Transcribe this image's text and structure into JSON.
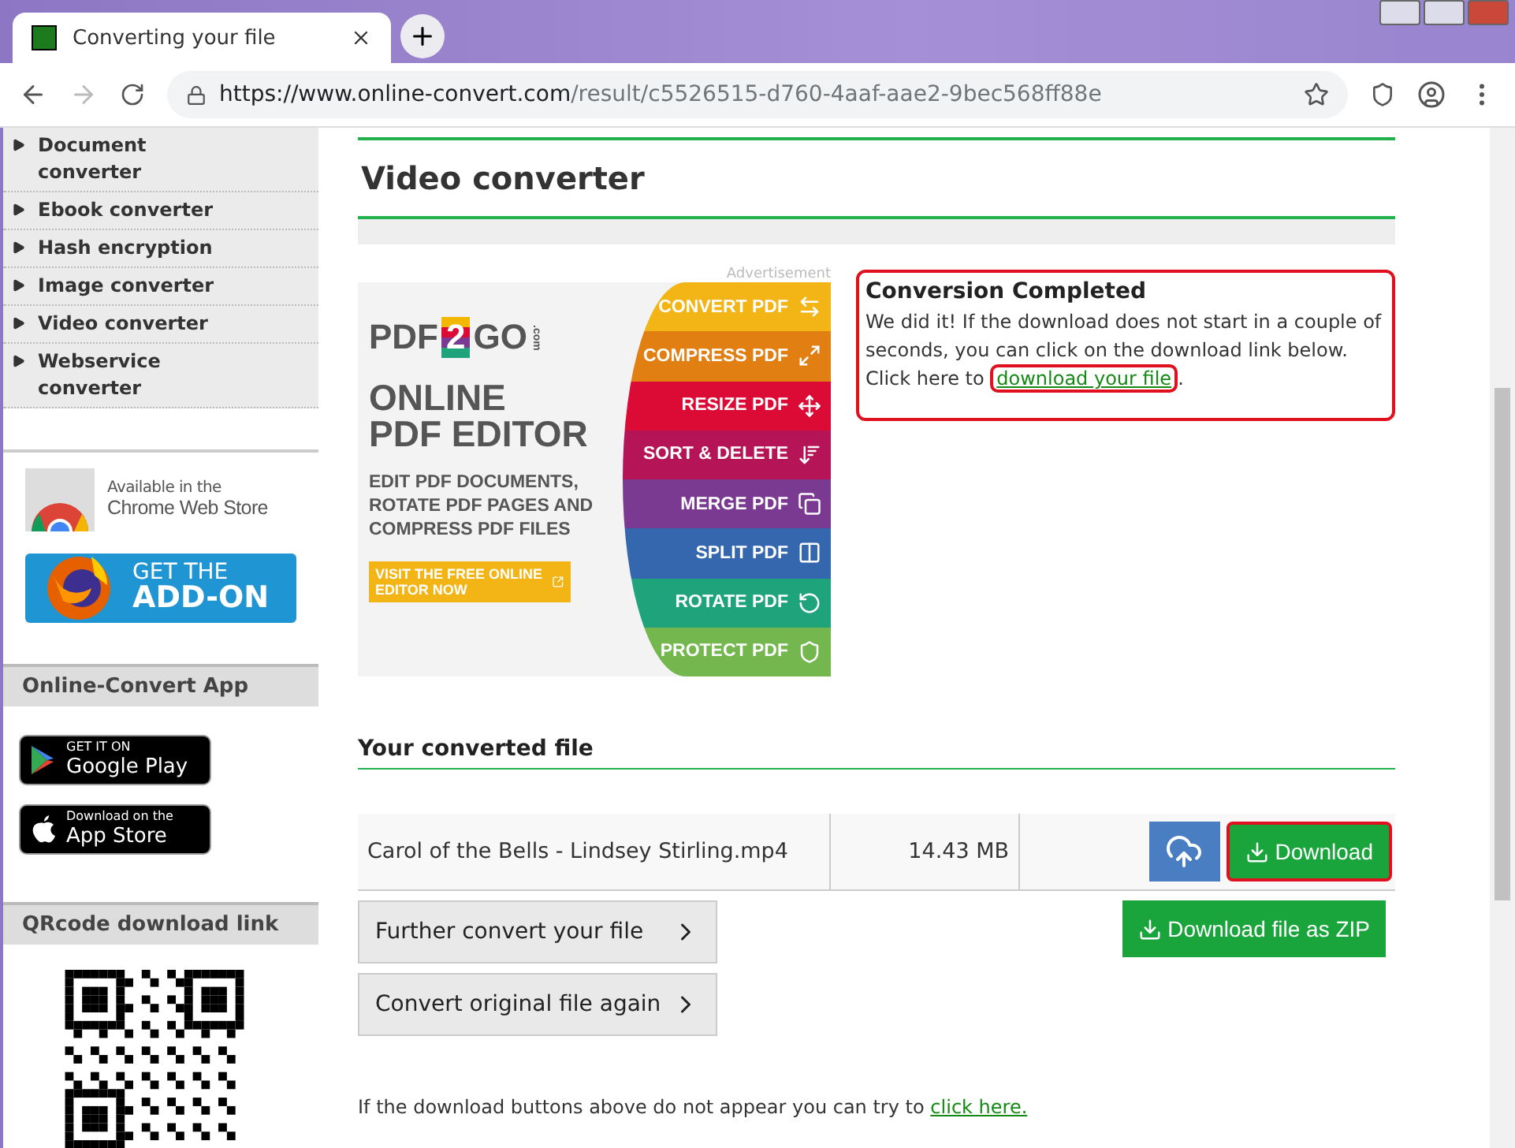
{
  "browser": {
    "tab_title": "Converting your file",
    "url_host": "https://www.online-convert.com",
    "url_path": "/result/c5526515-d760-4aaf-aae2-9bec568ff88e"
  },
  "sidebar": {
    "converters": [
      {
        "label": "Document converter"
      },
      {
        "label": "Ebook converter"
      },
      {
        "label": "Hash encryption"
      },
      {
        "label": "Image converter"
      },
      {
        "label": "Video converter"
      },
      {
        "label": "Webservice converter"
      }
    ],
    "chrome_store": {
      "line1": "Available in the",
      "line2": "Chrome Web Store"
    },
    "addon": {
      "line1": "GET THE",
      "line2": "ADD-ON"
    },
    "app_title": "Online-Convert App",
    "badges": [
      {
        "kind": "google",
        "small": "GET IT ON",
        "big": "Google Play"
      },
      {
        "kind": "apple",
        "small": "Download on the",
        "big": "App Store"
      }
    ],
    "qr_title": "QRcode download link"
  },
  "main": {
    "title": "Video converter",
    "ad": {
      "label": "Advertisement",
      "brand_left": "PDF",
      "brand_mid": "2",
      "brand_right": "GO",
      "brand_suffix": ".com",
      "headline": [
        "ONLINE",
        "PDF EDITOR"
      ],
      "description": "EDIT PDF DOCUMENTS, ROTATE PDF PAGES AND COMPRESS PDF FILES",
      "cta": "VISIT THE FREE ONLINE EDITOR NOW",
      "tools": [
        {
          "label": "CONVERT PDF",
          "color": "#f2b515",
          "kind": "convert"
        },
        {
          "label": "COMPRESS PDF",
          "color": "#e17f12",
          "kind": "compress"
        },
        {
          "label": "RESIZE PDF",
          "color": "#dc0b36",
          "kind": "resize"
        },
        {
          "label": "SORT & DELETE",
          "color": "#b51456",
          "kind": "sort"
        },
        {
          "label": "MERGE PDF",
          "color": "#7b3a91",
          "kind": "merge"
        },
        {
          "label": "SPLIT PDF",
          "color": "#3467ae",
          "kind": "split"
        },
        {
          "label": "ROTATE PDF",
          "color": "#1fa37a",
          "kind": "rotate"
        },
        {
          "label": "PROTECT PDF",
          "color": "#75b74f",
          "kind": "protect"
        }
      ]
    },
    "notice": {
      "title": "Conversion Completed",
      "text": "We did it! If the download does not start in a couple of seconds, you can click on the download link below. Click here to",
      "link": "download your file",
      "suffix": ".",
      "highlighted": true,
      "link_highlighted": true
    },
    "converted": {
      "title": "Your converted file",
      "file_name": "Carol of the Bells - Lindsey Stirling.mp4",
      "file_size": "14.43 MB",
      "download_label": "Download",
      "download_highlighted": true,
      "zip_label": "Download file as ZIP",
      "actions": [
        {
          "label": "Further convert your file"
        },
        {
          "label": "Convert original file again"
        }
      ],
      "footer_text": "If the download buttons above do not appear you can try to",
      "footer_link": "click here."
    }
  }
}
